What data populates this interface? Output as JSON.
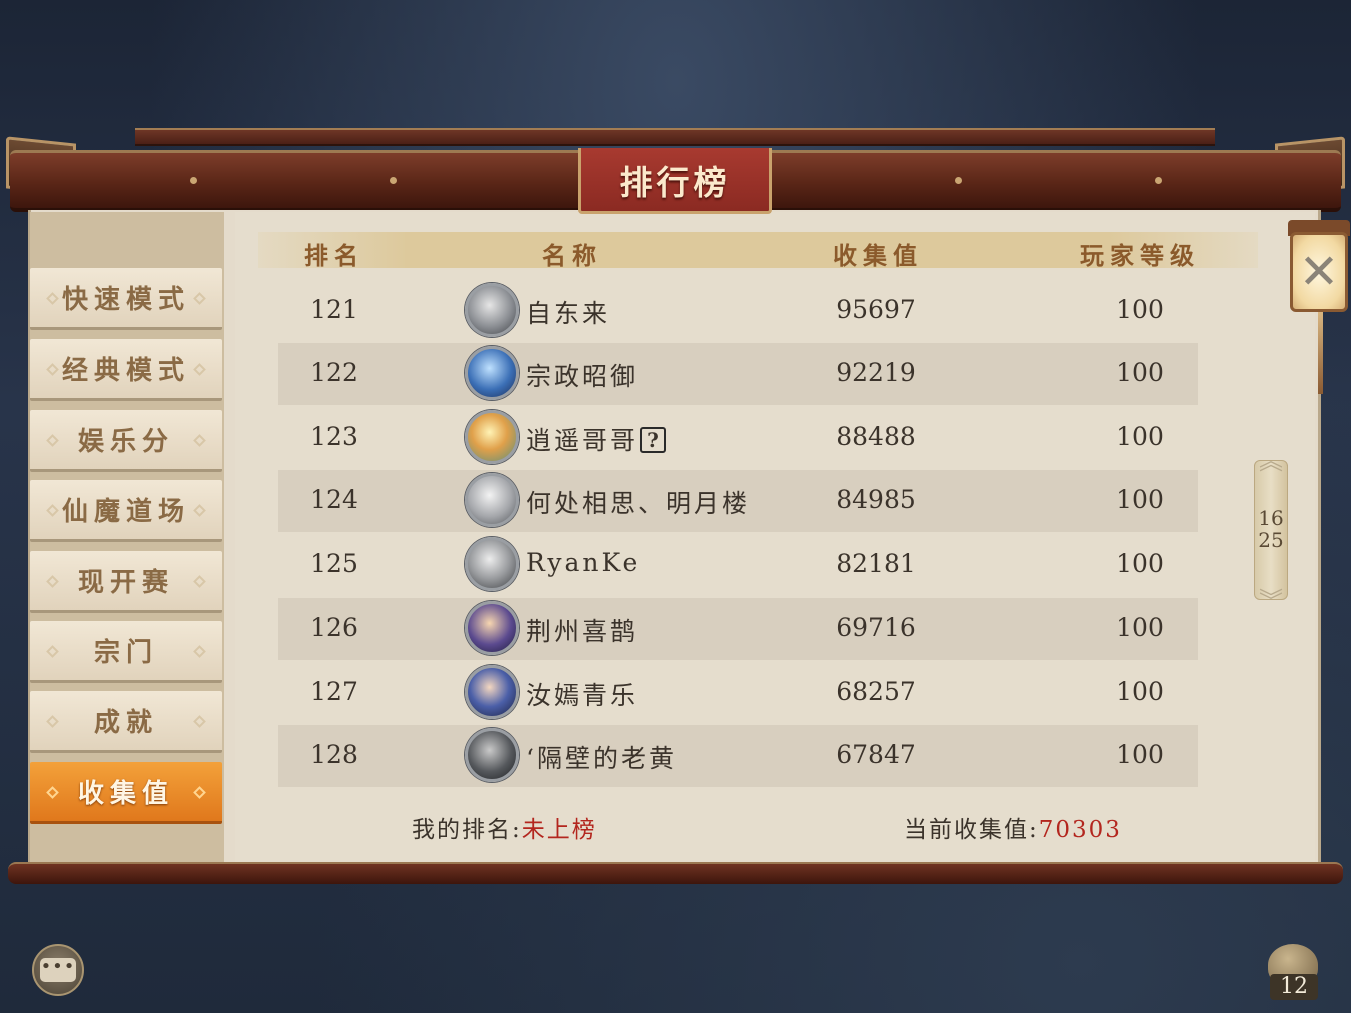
{
  "window": {
    "title": "排行榜"
  },
  "sidebar": {
    "items": [
      {
        "label": "快速模式",
        "active": false
      },
      {
        "label": "经典模式",
        "active": false
      },
      {
        "label": "娱乐分",
        "active": false
      },
      {
        "label": "仙魔道场",
        "active": false
      },
      {
        "label": "现开赛",
        "active": false
      },
      {
        "label": "宗门",
        "active": false
      },
      {
        "label": "成就",
        "active": false
      },
      {
        "label": "收集值",
        "active": true
      }
    ]
  },
  "table": {
    "headers": {
      "rank": "排名",
      "name": "名称",
      "value": "收集值",
      "level": "玩家等级"
    },
    "rows": [
      {
        "rank": "121",
        "name": "自东来",
        "value": "95697",
        "level": "100",
        "avatar_icon": "avatar-icon"
      },
      {
        "rank": "122",
        "name": "宗政昭御",
        "value": "92219",
        "level": "100",
        "avatar_icon": "avatar-icon"
      },
      {
        "rank": "123",
        "name": "逍遥哥哥",
        "value": "88488",
        "level": "100",
        "avatar_icon": "avatar-icon",
        "badge": "?"
      },
      {
        "rank": "124",
        "name": "何处相思、明月楼",
        "value": "84985",
        "level": "100",
        "avatar_icon": "avatar-icon"
      },
      {
        "rank": "125",
        "name": "RyanKe",
        "value": "82181",
        "level": "100",
        "avatar_icon": "avatar-icon"
      },
      {
        "rank": "126",
        "name": "荆州喜鹊",
        "value": "69716",
        "level": "100",
        "avatar_icon": "avatar-icon"
      },
      {
        "rank": "127",
        "name": "汝嫣青乐",
        "value": "68257",
        "level": "100",
        "avatar_icon": "avatar-icon"
      },
      {
        "rank": "128",
        "name": "‘隔壁的老黄",
        "value": "67847",
        "level": "100",
        "avatar_icon": "avatar-icon"
      }
    ]
  },
  "footer": {
    "my_rank_label": "我的排名:",
    "my_rank_value": "未上榜",
    "current_value_label": "当前收集值:",
    "current_value": "70303"
  },
  "pager": {
    "current": "16",
    "total": "25"
  },
  "close": {
    "icon": "close-icon",
    "glyph": "✕"
  },
  "bottom": {
    "chat_icon": "chat-icon",
    "chat_glyph": "•••",
    "stamina_icon": "stamina-icon",
    "stamina_count": "12"
  },
  "colors": {
    "accent_red": "#b3261e",
    "active_tab": "#e88a27",
    "header_text": "#8b5a2b"
  }
}
